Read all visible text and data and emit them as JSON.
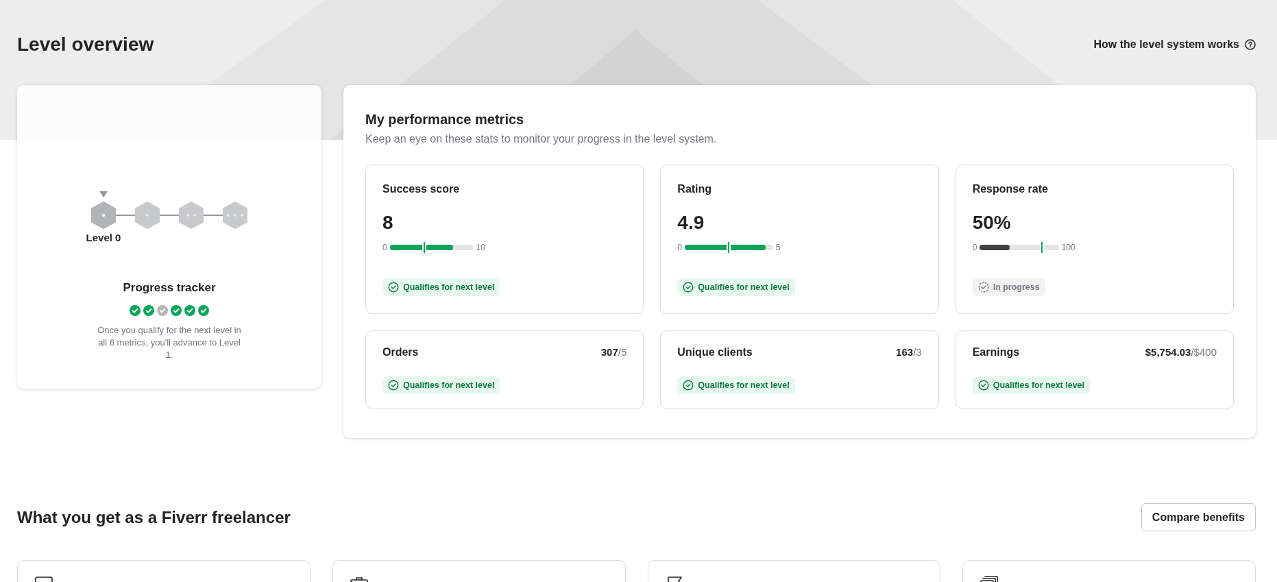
{
  "page": {
    "title": "Level overview",
    "help_link": "How the level system works"
  },
  "level_card": {
    "levels": [
      {
        "label": "Level 0",
        "selected": true
      },
      {
        "selected": false
      },
      {
        "selected": false
      },
      {
        "selected": false
      }
    ],
    "title": "Progress tracker",
    "checks": [
      {
        "checked": true
      },
      {
        "checked": true
      },
      {
        "checked": false
      },
      {
        "checked": true
      },
      {
        "checked": true
      },
      {
        "checked": true
      }
    ],
    "description": "Once you qualify for the next level in all 6 metrics, you'll advance to Level 1."
  },
  "metrics_panel": {
    "title": "My performance metrics",
    "subtitle": "Keep an eye on these stats to monitor your progress in the level system.",
    "metrics": [
      {
        "kind": "bar",
        "name": "Success score",
        "value": "8",
        "min": "0",
        "max": "10",
        "level": 0.76,
        "target": {
          "level": 0.41
        },
        "status": {
          "kind": "qualified",
          "label": "Qualifies for next level"
        }
      },
      {
        "kind": "bar",
        "name": "Rating",
        "value": "4.9",
        "min": "0",
        "max": "5",
        "level": 0.92,
        "target": {
          "level": 0.5
        },
        "status": {
          "kind": "qualified",
          "label": "Qualifies for next level"
        }
      },
      {
        "kind": "bar",
        "name": "Response rate",
        "value": "50%",
        "min": "0",
        "max": "100",
        "level": 0.38,
        "target": {
          "level": 0.79
        },
        "status": {
          "kind": "in_progress",
          "label": "In progress"
        }
      },
      {
        "kind": "count",
        "name": "Orders",
        "value": "**307**/5",
        "status": {
          "kind": "qualified",
          "label": "Qualifies for next level"
        }
      },
      {
        "kind": "count",
        "name": "Unique clients",
        "value": "**163**/3",
        "status": {
          "kind": "qualified",
          "label": "Qualifies for next level"
        }
      },
      {
        "kind": "count",
        "name": "Earnings",
        "value": "**$5,754.03**/$400",
        "status": {
          "kind": "qualified",
          "label": "Qualifies for next level"
        }
      }
    ]
  },
  "benefits": {
    "title": "What you get as a Fiverr freelancer",
    "button": "Compare benefits",
    "cards": [
      {
        "kind": "screen"
      },
      {
        "kind": "briefcase"
      },
      {
        "kind": "flag"
      },
      {
        "kind": "stack"
      }
    ]
  }
}
